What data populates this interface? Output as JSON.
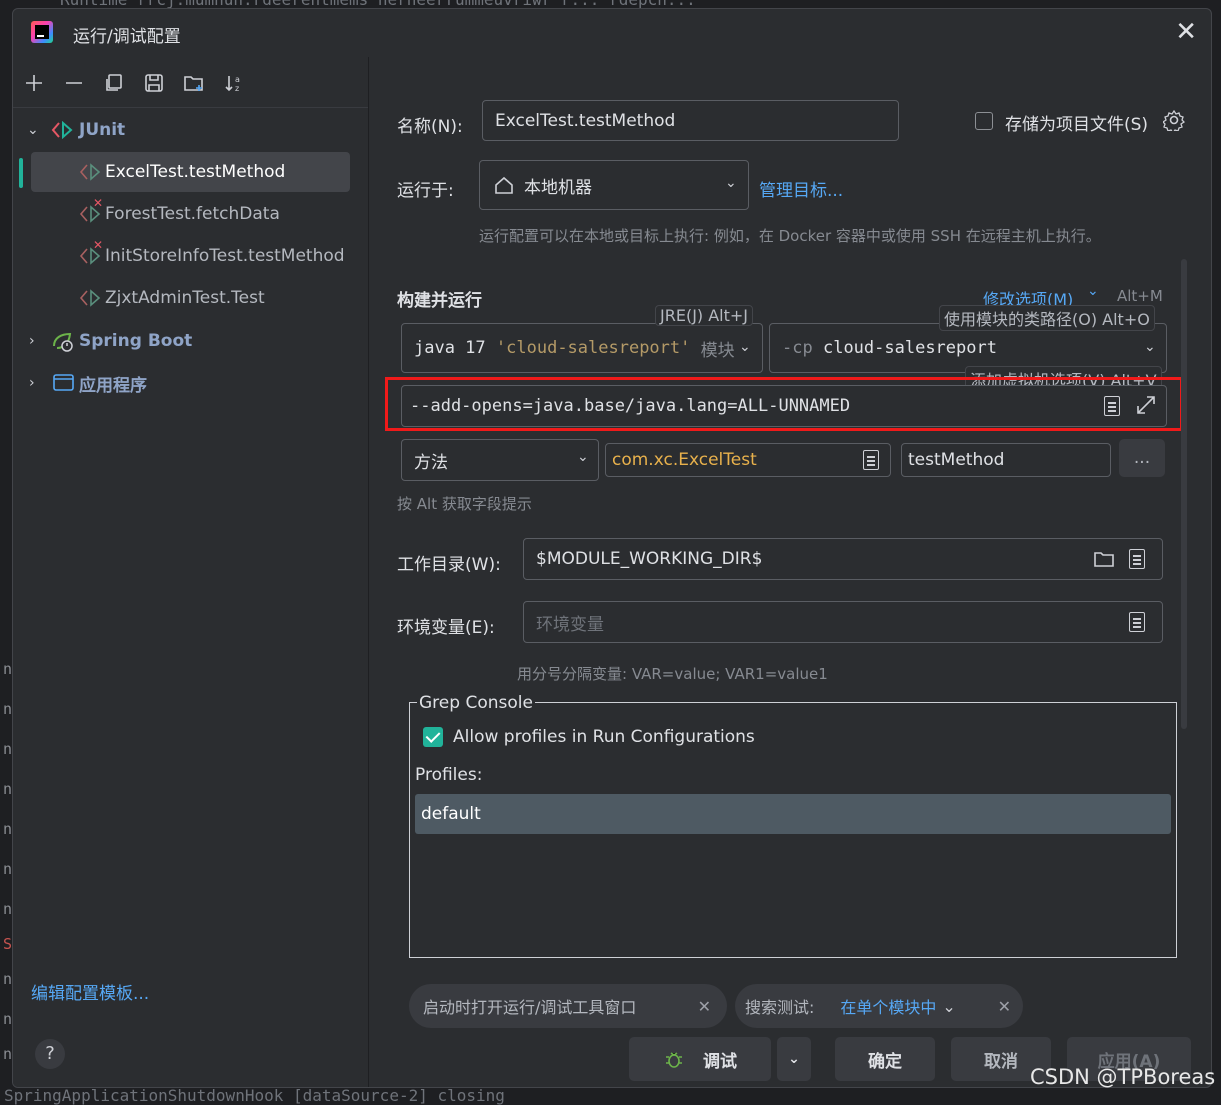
{
  "window": {
    "title": "运行/调试配置",
    "close_symbol": "✕"
  },
  "background": {
    "code_top": "Runtime rrcj.mumnun.rdeerentmems nerneerrummeuvriwr r...  rdepcn... ",
    "code_bottom": "SpringApplicationShutdownHook  [dataSource-2] closing"
  },
  "left_panel": {
    "tree": {
      "junit": {
        "label": "JUnit",
        "items": [
          {
            "label": "ExcelTest.testMethod",
            "selected": true,
            "error": false
          },
          {
            "label": "ForestTest.fetchData",
            "selected": false,
            "error": true
          },
          {
            "label": "InitStoreInfoTest.testMethod",
            "selected": false,
            "error": true
          },
          {
            "label": "ZjxtAdminTest.Test",
            "selected": false,
            "error": false
          }
        ]
      },
      "spring_boot": {
        "label": "Spring Boot"
      },
      "application": {
        "label": "应用程序"
      }
    },
    "edit_templates": "编辑配置模板...",
    "help": "?"
  },
  "form": {
    "name_label": "名称(N):",
    "name_value": "ExcelTest.testMethod",
    "store_as_project_file": "存储为项目文件(S)",
    "run_on_label": "运行于:",
    "run_on_value": "本地机器",
    "manage_targets": "管理目标...",
    "run_on_hint": "运行配置可以在本地或目标上执行: 例如，在 Docker 容器中或使用 SSH 在远程主机上执行。",
    "build_run_title": "构建并运行",
    "modify_options": "修改选项(M)",
    "modify_options_shortcut": "Alt+M",
    "jre_tip": "JRE(J) Alt+J",
    "jre_value_prefix": "java 17",
    "jre_value_module": "'cloud-salesreport'",
    "jre_value_suffix": "模块",
    "classpath_tip": "使用模块的类路径(O) Alt+O",
    "classpath_prefix": "-cp",
    "classpath_value": "cloud-salesreport",
    "vm_options_tip": "添加虚拟机选项(V) Alt+V",
    "vm_options_value": "--add-opens=java.base/java.lang=ALL-UNNAMED",
    "test_kind": "方法",
    "test_class": "com.xc.ExcelTest",
    "test_method": "testMethod",
    "more_button": "...",
    "alt_hint": "按 Alt 获取字段提示",
    "workdir_label": "工作目录(W):",
    "workdir_value": "$MODULE_WORKING_DIR$",
    "env_label": "环境变量(E):",
    "env_placeholder": "环境变量",
    "env_hint": "用分号分隔变量: VAR=value; VAR1=value1"
  },
  "grep_console": {
    "title": "Grep Console",
    "allow_profiles": "Allow profiles in Run Configurations",
    "allow_profiles_checked": true,
    "profiles_label": "Profiles:",
    "profiles": [
      "default"
    ]
  },
  "chips": {
    "open_tool_window": "启动时打开运行/调试工具窗口",
    "search_tests_label": "搜索测试:",
    "search_tests_value": "在单个模块中"
  },
  "buttons": {
    "debug": "调试",
    "ok": "确定",
    "cancel": "取消",
    "apply": "应用(A)"
  },
  "watermark": "CSDN @TPBoreas",
  "colors": {
    "accent": "#21b39a",
    "link": "#56a8f5",
    "highlight_frame": "#f01a1a",
    "test_class_text": "#e8b14c"
  }
}
